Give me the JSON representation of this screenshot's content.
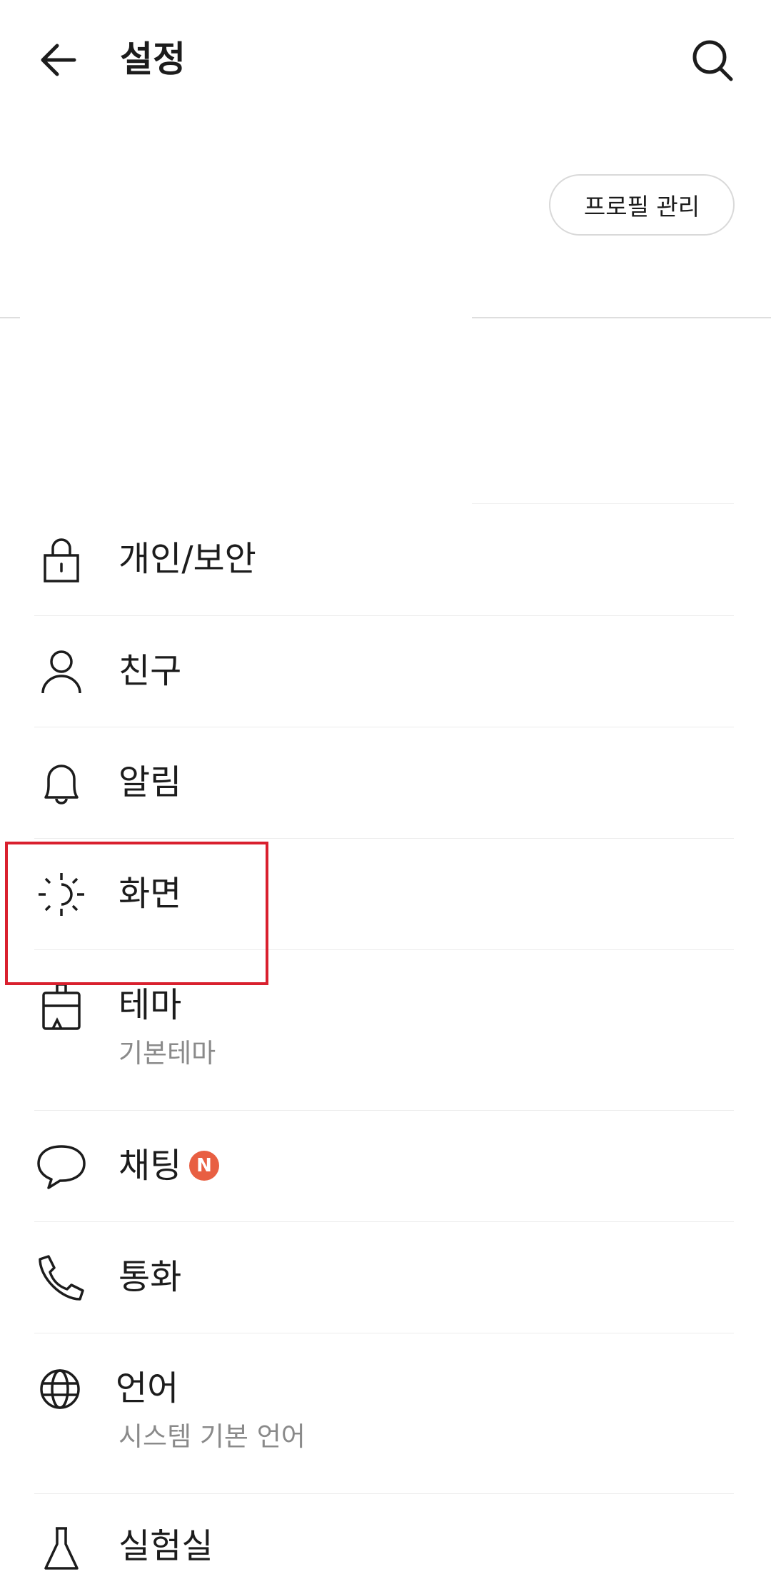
{
  "header": {
    "title": "설정",
    "back_icon": "arrow-left-icon",
    "search_icon": "search-icon"
  },
  "profile": {
    "manage_button": "프로필 관리"
  },
  "menu": {
    "items": [
      {
        "label": "개인/보안",
        "icon": "lock-icon"
      },
      {
        "label": "친구",
        "icon": "person-icon"
      },
      {
        "label": "알림",
        "icon": "bell-icon"
      },
      {
        "label": "화면",
        "icon": "display-brightness-icon"
      },
      {
        "label": "테마",
        "sub": "기본테마",
        "icon": "paint-brush-icon"
      },
      {
        "label": "채팅",
        "badge": "N",
        "icon": "chat-bubble-icon"
      },
      {
        "label": "통화",
        "icon": "phone-icon"
      },
      {
        "label": "언어",
        "sub": "시스템 기본 언어",
        "icon": "globe-icon"
      },
      {
        "label": "실험실",
        "icon": "flask-icon"
      }
    ]
  },
  "colors": {
    "badge": "#e85f42",
    "highlight": "#d9202e",
    "divider": "#dedede",
    "subtext": "#8a8a8a"
  }
}
